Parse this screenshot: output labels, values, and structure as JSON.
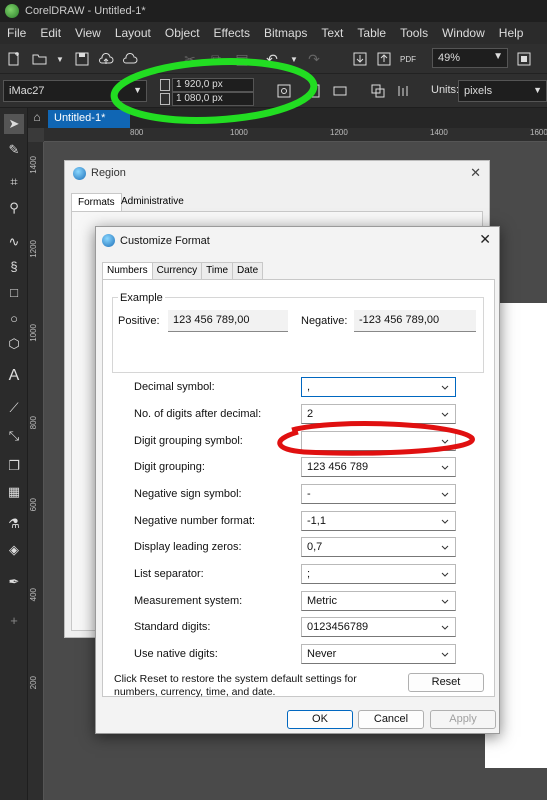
{
  "app": {
    "title": "CorelDRAW - Untitled-1*"
  },
  "menu": [
    {
      "label": "File"
    },
    {
      "label": "Edit"
    },
    {
      "label": "View"
    },
    {
      "label": "Layout"
    },
    {
      "label": "Object"
    },
    {
      "label": "Effects"
    },
    {
      "label": "Bitmaps"
    },
    {
      "label": "Text"
    },
    {
      "label": "Table"
    },
    {
      "label": "Tools"
    },
    {
      "label": "Window"
    },
    {
      "label": "Help"
    }
  ],
  "toolbar": {
    "zoom_value": "49%"
  },
  "propbar": {
    "preset": "iMac27",
    "width": "1 920,0 px",
    "height": "1 080,0 px",
    "units_label": "Units:",
    "units_value": "pixels"
  },
  "document": {
    "tab_label": "Untitled-1*",
    "ruler_top": [
      "800",
      "1000",
      "1200",
      "1400",
      "1600"
    ],
    "ruler_left": [
      "1400",
      "1200",
      "1000",
      "800",
      "600",
      "400",
      "200"
    ]
  },
  "region_dialog": {
    "title": "Region",
    "tabs": [
      "Formats",
      "Administrative"
    ]
  },
  "customize_dialog": {
    "title": "Customize Format",
    "tabs": [
      "Numbers",
      "Currency",
      "Time",
      "Date"
    ],
    "example": {
      "label": "Example",
      "positive_label": "Positive:",
      "positive_value": "123 456 789,00",
      "negative_label": "Negative:",
      "negative_value": "-123 456 789,00"
    },
    "rows": [
      {
        "label": "Decimal symbol:",
        "value": ","
      },
      {
        "label": "No. of digits after decimal:",
        "value": "2"
      },
      {
        "label": "Digit grouping symbol:",
        "value": ""
      },
      {
        "label": "Digit grouping:",
        "value": "123 456 789"
      },
      {
        "label": "Negative sign symbol:",
        "value": "-"
      },
      {
        "label": "Negative number format:",
        "value": "-1,1"
      },
      {
        "label": "Display leading zeros:",
        "value": "0,7"
      },
      {
        "label": "List separator:",
        "value": ";"
      },
      {
        "label": "Measurement system:",
        "value": "Metric"
      },
      {
        "label": "Standard digits:",
        "value": "0123456789"
      },
      {
        "label": "Use native digits:",
        "value": "Never"
      }
    ],
    "note": "Click Reset to restore the system default settings for numbers, currency, time, and date.",
    "reset_label": "Reset",
    "ok_label": "OK",
    "cancel_label": "Cancel",
    "apply_label": "Apply"
  },
  "annotations": {
    "green_color": "#22dd22",
    "red_color": "#e01010"
  }
}
